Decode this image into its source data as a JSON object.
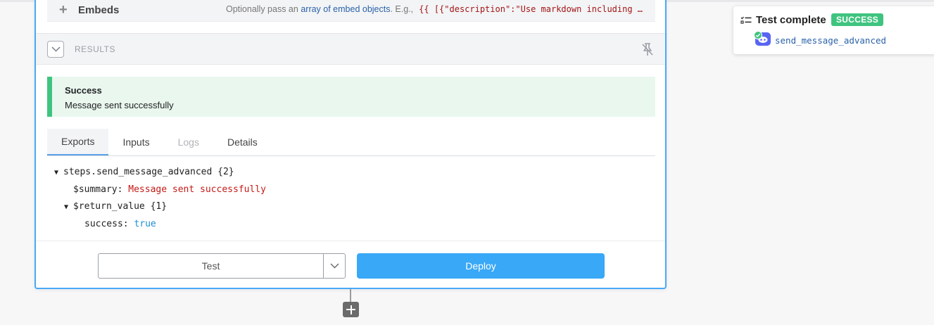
{
  "embeds": {
    "label": "Embeds",
    "desc_prefix": "Optionally pass an",
    "desc_link": "array of embed objects",
    "desc_suffix": ". E.g.,",
    "code_example": "{{ [{\"description\":\"Use markdown including …"
  },
  "results": {
    "label": "RESULTS"
  },
  "success": {
    "title": "Success",
    "message": "Message sent successfully",
    "accent_color": "#3fc480"
  },
  "tabs": [
    {
      "label": "Exports",
      "active": true
    },
    {
      "label": "Inputs",
      "active": false
    },
    {
      "label": "Logs",
      "active": false,
      "disabled": true
    },
    {
      "label": "Details",
      "active": false
    }
  ],
  "exports_tree": {
    "root": "steps.send_message_advanced {2}",
    "summary_key": "$summary:",
    "summary_value": "Message sent successfully",
    "return_key": "$return_value {1}",
    "success_key": "success:",
    "success_value": "true"
  },
  "footer": {
    "test_label": "Test",
    "deploy_label": "Deploy",
    "deploy_color": "#38a8f7"
  },
  "toast": {
    "title": "Test complete",
    "badge": "SUCCESS",
    "step_name": "send_message_advanced"
  },
  "icons": {
    "embeds_add": "plus-icon",
    "results_toggle": "chevron-down-icon",
    "pin": "unpin-icon",
    "dropdown": "chevron-down-icon",
    "add_step": "plus-icon",
    "toast_list": "list-check-icon",
    "step_app": "discord-icon",
    "step_status": "check-circle-icon"
  }
}
